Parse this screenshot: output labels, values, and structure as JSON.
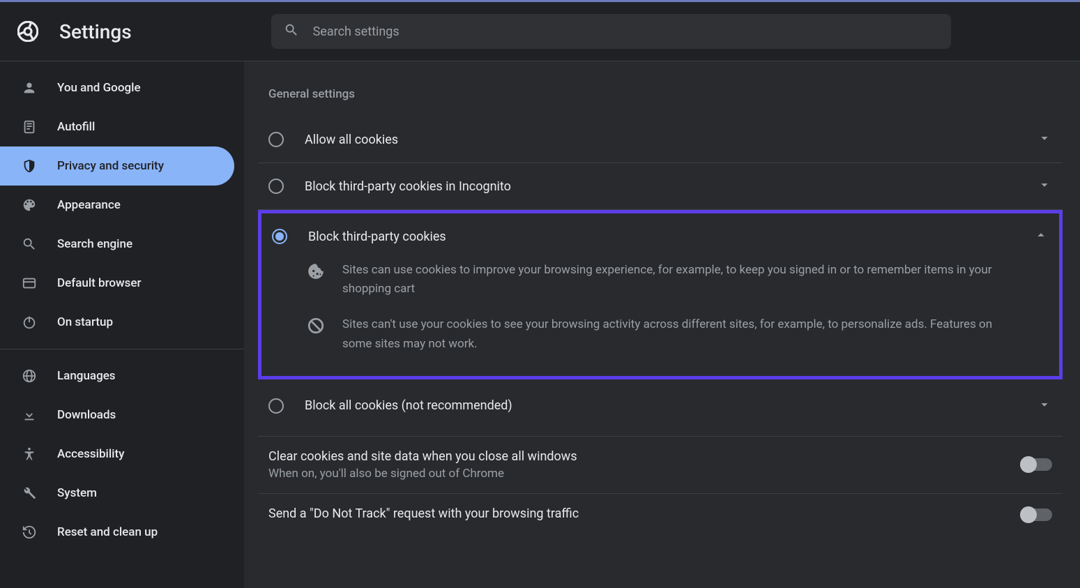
{
  "header": {
    "title": "Settings",
    "search_placeholder": "Search settings"
  },
  "sidebar": {
    "section1": [
      {
        "label": "You and Google",
        "icon": "person"
      },
      {
        "label": "Autofill",
        "icon": "autofill"
      },
      {
        "label": "Privacy and security",
        "icon": "shield",
        "active": true
      },
      {
        "label": "Appearance",
        "icon": "palette"
      },
      {
        "label": "Search engine",
        "icon": "search"
      },
      {
        "label": "Default browser",
        "icon": "browser"
      },
      {
        "label": "On startup",
        "icon": "power"
      }
    ],
    "section2": [
      {
        "label": "Languages",
        "icon": "globe"
      },
      {
        "label": "Downloads",
        "icon": "download"
      },
      {
        "label": "Accessibility",
        "icon": "accessibility"
      },
      {
        "label": "System",
        "icon": "wrench"
      },
      {
        "label": "Reset and clean up",
        "icon": "restore"
      }
    ]
  },
  "main": {
    "section_heading": "General settings",
    "options": [
      {
        "label": "Allow all cookies",
        "selected": false,
        "expanded": false
      },
      {
        "label": "Block third-party cookies in Incognito",
        "selected": false,
        "expanded": false
      },
      {
        "label": "Block third-party cookies",
        "selected": true,
        "expanded": true,
        "highlighted": true
      },
      {
        "label": "Block all cookies (not recommended)",
        "selected": false,
        "expanded": false
      }
    ],
    "details": [
      "Sites can use cookies to improve your browsing experience, for example, to keep you signed in or to remember items in your shopping cart",
      "Sites can't use your cookies to see your browsing activity across different sites, for example, to personalize ads. Features on some sites may not work."
    ],
    "settings": [
      {
        "title": "Clear cookies and site data when you close all windows",
        "sub": "When on, you'll also be signed out of Chrome",
        "toggle": false
      },
      {
        "title": "Send a \"Do Not Track\" request with your browsing traffic",
        "sub": "",
        "toggle": false
      }
    ]
  }
}
